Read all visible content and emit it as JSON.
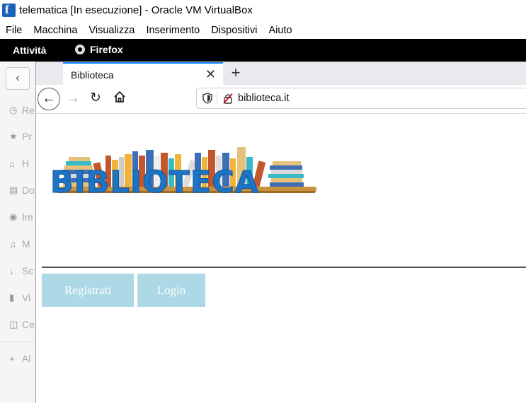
{
  "vbox": {
    "title": "telematica [In esecuzione] - Oracle VM VirtualBox",
    "menu": [
      "File",
      "Macchina",
      "Visualizza",
      "Inserimento",
      "Dispositivi",
      "Aiuto"
    ]
  },
  "gnome": {
    "activities": "Attività",
    "app_name": "Firefox"
  },
  "background_window": {
    "items": [
      {
        "icon": "clock-icon",
        "label": "Re"
      },
      {
        "icon": "star-icon",
        "label": "Pr"
      },
      {
        "icon": "home-icon",
        "label": "H"
      },
      {
        "icon": "document-icon",
        "label": "Do"
      },
      {
        "icon": "camera-icon",
        "label": "Im"
      },
      {
        "icon": "music-icon",
        "label": "M"
      },
      {
        "icon": "download-icon",
        "label": "Sc"
      },
      {
        "icon": "video-icon",
        "label": "Vi"
      },
      {
        "icon": "trash-icon",
        "label": "Ce"
      },
      {
        "icon": "plus-icon",
        "label": "Al"
      }
    ]
  },
  "browser": {
    "tab_title": "Biblioteca",
    "url": "biblioteca.it"
  },
  "page": {
    "logo_text": "BIBLIOTECA",
    "buttons": {
      "register": "Registrati",
      "login": "Login"
    }
  },
  "colors": {
    "button_bg": "#add8e6",
    "logo_blue": "#1e74c4",
    "tab_accent": "#0a84ff"
  }
}
